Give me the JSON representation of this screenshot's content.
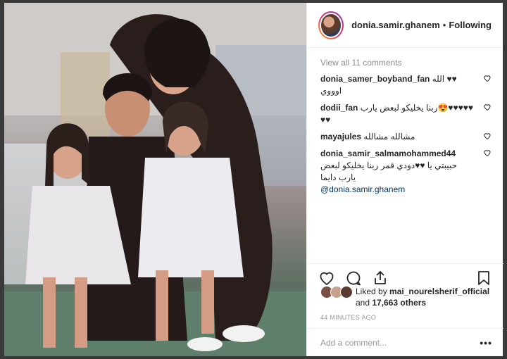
{
  "post": {
    "username": "donia.samir.ghanem",
    "separator": "•",
    "follow_status": "Following"
  },
  "comments": {
    "view_all": "View all 11 comments",
    "items": [
      {
        "user": "donia_samer_boyband_fan",
        "text": "♥♥ الله اوووي"
      },
      {
        "user": "dodii_fan",
        "text": "♥♥♥♥♥😍ربنا يخليكو لبعض يارب ♥♥"
      },
      {
        "user": "mayajules",
        "text": "مشالله مشالله"
      },
      {
        "user": "donia_samir_salmamohammed44",
        "text": "حبيبتي يا ♥♥دودي قمر ربنا يخليكو لبعض يارب دايما",
        "mention": "@donia.samir.ghanem"
      }
    ]
  },
  "likes": {
    "prefix": "Liked by",
    "user": "mai_nourelsherif_official",
    "joiner": "and",
    "others": "17,663 others"
  },
  "timestamp": "44 MINUTES AGO",
  "add_comment": {
    "placeholder": "Add a comment..."
  },
  "more_label": "•••",
  "icons": {
    "heart": "heart-icon",
    "comment": "comment-icon",
    "share": "share-icon",
    "bookmark": "bookmark-icon",
    "comment_like": "heart-outline-icon"
  },
  "colors": {
    "text": "#262626",
    "secondary": "#8e8e8e",
    "mention": "#003569"
  }
}
